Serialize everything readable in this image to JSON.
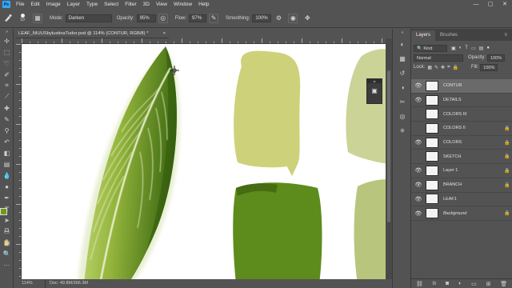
{
  "menu": [
    "File",
    "Edit",
    "Image",
    "Layer",
    "Type",
    "Select",
    "Filter",
    "3D",
    "View",
    "Window",
    "Help"
  ],
  "window_controls": [
    "—",
    "▢",
    "✕"
  ],
  "options": {
    "brush_size": "10",
    "mode_label": "Mode:",
    "mode_value": "Darken",
    "opacity_label": "Opacity:",
    "opacity_value": "95%",
    "flow_label": "Flow:",
    "flow_value": "97%",
    "smoothing_label": "Smoothing:",
    "smoothing_value": "100%"
  },
  "document": {
    "tab_title": "LEAF_NIUUSbylustinaTudor.psd @ 114% (CONTUR, RGB/8) *",
    "close": "×"
  },
  "status": {
    "zoom": "114%",
    "doc_info": "Doc: 49.8M/366.3M"
  },
  "colors": {
    "foreground": "#6e9a1a",
    "background": "#ffffff",
    "swatch_light": "#cdd27a",
    "swatch_dark": "#5e8c1c",
    "swatch_pale": "#ccd396"
  },
  "layers_panel": {
    "tabs": [
      "Layers",
      "Brushes"
    ],
    "kind": "Kind",
    "blend_mode": "Normal",
    "opacity_label": "Opacity:",
    "opacity_value": "100%",
    "lock_label": "Lock:",
    "fill_label": "Fill:",
    "fill_value": "100%",
    "layers": [
      {
        "name": "CONTUR",
        "visible": true,
        "locked": false,
        "selected": true
      },
      {
        "name": "DETAILS",
        "visible": true,
        "locked": false,
        "selected": false
      },
      {
        "name": "COLORS III",
        "visible": false,
        "locked": false,
        "selected": false
      },
      {
        "name": "COLORS II",
        "visible": false,
        "locked": true,
        "selected": false
      },
      {
        "name": "COLORS",
        "visible": true,
        "locked": true,
        "selected": false
      },
      {
        "name": "SKETCH",
        "visible": false,
        "locked": true,
        "selected": false
      },
      {
        "name": "Layer 1",
        "visible": true,
        "locked": true,
        "selected": false
      },
      {
        "name": "BRANCH",
        "visible": true,
        "locked": true,
        "selected": false
      },
      {
        "name": "LEAF1",
        "visible": true,
        "locked": false,
        "selected": false
      },
      {
        "name": "Background",
        "visible": true,
        "locked": true,
        "selected": false
      }
    ]
  }
}
